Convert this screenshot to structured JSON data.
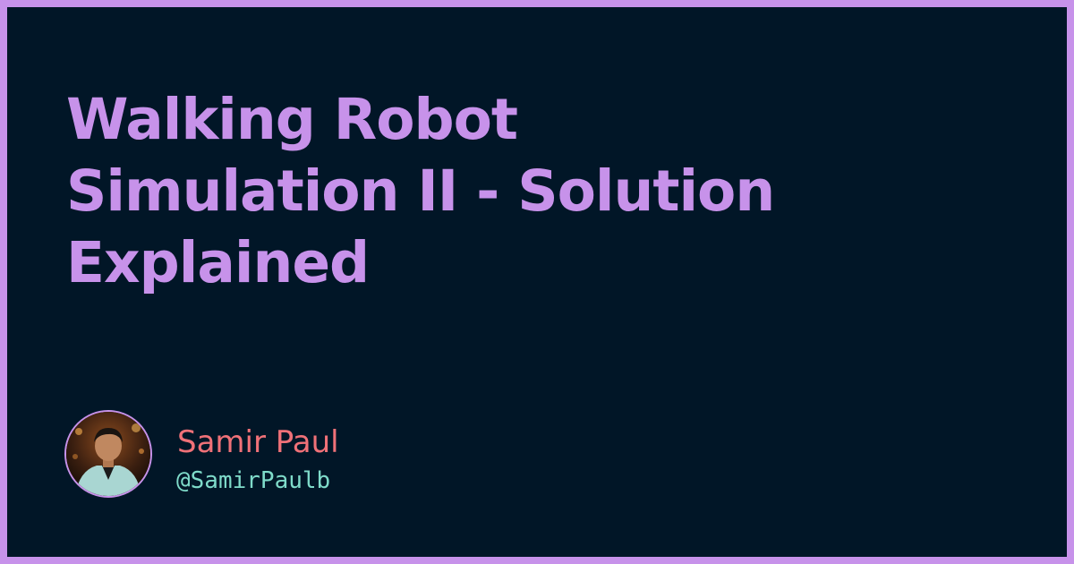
{
  "post": {
    "title_lines": [
      "Walking Robot",
      "Simulation II - Solution",
      "Explained"
    ]
  },
  "author": {
    "name": "Samir Paul",
    "handle": "@SamirPaulb",
    "avatar_icon": "profile-photo-avatar"
  },
  "colors": {
    "frame": "#c792ea",
    "background": "#011627",
    "title": "#c792ea",
    "author_name": "#f07178",
    "author_handle": "#7fdbca"
  }
}
